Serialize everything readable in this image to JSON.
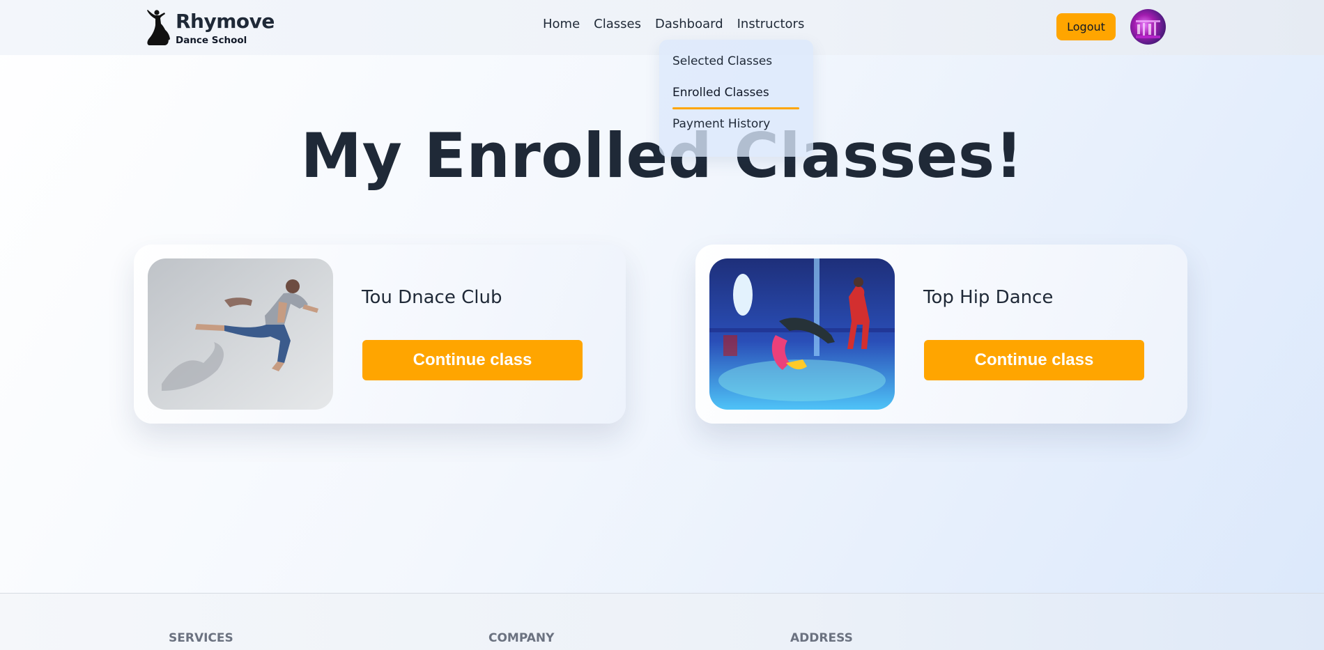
{
  "navbar": {
    "brand_name": "Rhymove",
    "brand_subtitle": "Dance School",
    "links": [
      "Home",
      "Classes",
      "Dashboard",
      "Instructors"
    ],
    "logout_label": "Logout"
  },
  "dropdown": {
    "items": [
      "Selected Classes",
      "Enrolled Classes",
      "Payment History"
    ],
    "active_item": "Enrolled Classes"
  },
  "page": {
    "title": "My Enrolled Classes!"
  },
  "classes": [
    {
      "name": "Tou Dnace Club",
      "button_label": "Continue class"
    },
    {
      "name": "Top Hip Dance",
      "button_label": "Continue class"
    }
  ],
  "footer": {
    "headings": [
      "SERVICES",
      "COMPANY",
      "ADDRESS"
    ]
  },
  "colors": {
    "accent": "#ffa500",
    "text_dark": "#1f2937",
    "footer_heading": "#6b7280"
  }
}
